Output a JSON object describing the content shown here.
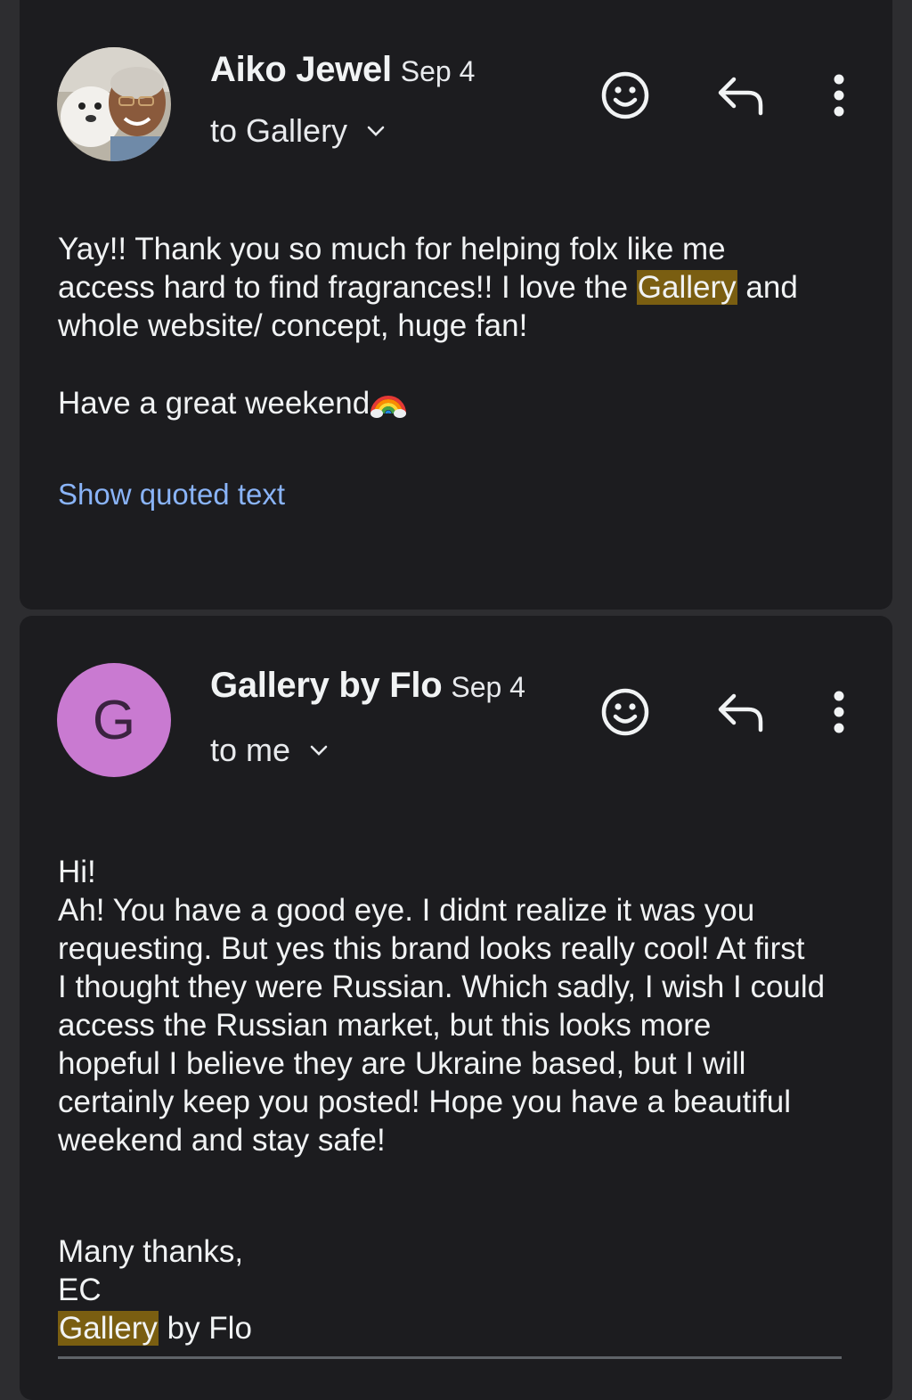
{
  "messages": [
    {
      "sender": "Aiko Jewel",
      "date": "Sep 4",
      "recipient": "to Gallery",
      "body_line1": "Yay!! Thank you so much for helping folx like me",
      "body_line2_pre": "access hard to find fragrances!! I love the ",
      "body_line2_highlight": "Gallery",
      "body_line2_post": " and",
      "body_line3": "whole website/ concept, huge fan!",
      "closing": "Have a great weekend",
      "show_quoted": "Show quoted text",
      "avatar": "profile-photo-with-dog"
    },
    {
      "sender": "Gallery by Flo",
      "date": "Sep 4",
      "recipient": "to me",
      "avatar_letter": "G",
      "avatar_color": "#c97ad1",
      "body_lines": [
        "Hi!",
        "Ah! You have a good eye. I didnt realize it was you",
        "requesting. But yes this brand looks really cool! At first",
        "I thought they were Russian. Which sadly, I wish I could",
        "access the Russian market, but this looks more",
        "hopeful I believe they are Ukraine based, but I will",
        "certainly keep you posted! Hope you have a beautiful",
        "weekend and stay safe!"
      ],
      "sig_line1": "Many thanks,",
      "sig_line2": "EC",
      "sig_highlight": "Gallery",
      "sig_post": " by Flo"
    }
  ],
  "colors": {
    "background": "#2d2d30",
    "card": "#1c1c1f",
    "link": "#8ab4f8",
    "highlight": "#7a5e11"
  },
  "icons": [
    "emoji-reaction-icon",
    "reply-icon",
    "more-vert-icon",
    "chevron-down-icon"
  ]
}
